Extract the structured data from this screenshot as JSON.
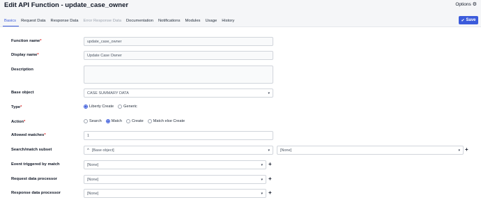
{
  "header": {
    "title": "Edit API Function - update_case_owner",
    "options_label": "Options",
    "options_icon": "gear-icon"
  },
  "tabs": [
    {
      "label": "Basics",
      "state": "active"
    },
    {
      "label": "Request Data",
      "state": "normal"
    },
    {
      "label": "Response Data",
      "state": "normal"
    },
    {
      "label": "Error Response Data",
      "state": "disabled"
    },
    {
      "label": "Documentation",
      "state": "normal"
    },
    {
      "label": "Notifications",
      "state": "normal"
    },
    {
      "label": "Modules",
      "state": "normal"
    },
    {
      "label": "Usage",
      "state": "normal"
    },
    {
      "label": "History",
      "state": "normal"
    }
  ],
  "save_button": {
    "label": "Save",
    "icon": "checkmark-icon"
  },
  "colors": {
    "accent": "#3b5bdb",
    "required": "#dc2626"
  },
  "form": {
    "function_name": {
      "label": "Function name",
      "required_mark": "*",
      "value": "update_case_owner"
    },
    "display_name": {
      "label": "Display name",
      "required_mark": "*",
      "value": "Update Case Owner"
    },
    "description": {
      "label": "Description",
      "value": ""
    },
    "base_object": {
      "label": "Base object",
      "value": "CASE SUMMARY DATA"
    },
    "type": {
      "label": "Type",
      "required_mark": "*",
      "options": [
        "Liberty Create",
        "Generic"
      ],
      "selected": "Liberty Create"
    },
    "action": {
      "label": "Action",
      "required_mark": "*",
      "options": [
        "Search",
        "Match",
        "Create",
        "Match else Create"
      ],
      "selected": "Match"
    },
    "allowed_matches": {
      "label": "Allowed matches",
      "required_mark": "*",
      "value": "1"
    },
    "search_match_subset": {
      "label": "Search/match subset",
      "value": "[Base object]",
      "second_value": "[None]"
    },
    "event_triggered": {
      "label": "Event triggered by match",
      "value": "[None]"
    },
    "request_processor": {
      "label": "Request data processor",
      "value": "[None]"
    },
    "response_processor": {
      "label": "Response data processor",
      "value": "[None]"
    }
  }
}
